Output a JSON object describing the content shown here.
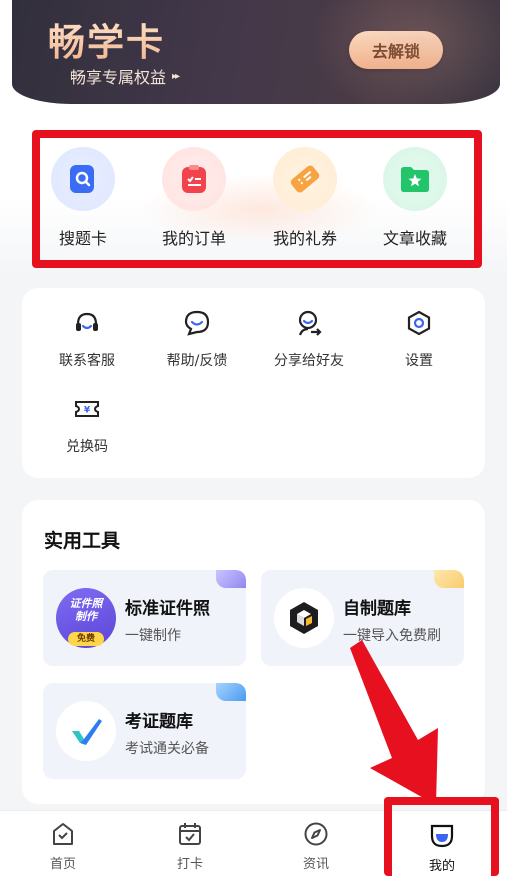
{
  "banner": {
    "title": "畅学卡",
    "subtitle": "畅享专属权益",
    "arrows": "▸▸",
    "unlock_label": "去解锁"
  },
  "quick_entries": [
    {
      "label": "搜题卡",
      "icon": "search-card-icon",
      "color": "#3b6cf6"
    },
    {
      "label": "我的订单",
      "icon": "order-clipboard-icon",
      "color": "#f2434d"
    },
    {
      "label": "我的礼券",
      "icon": "coupon-ticket-icon",
      "color": "#f7a341"
    },
    {
      "label": "文章收藏",
      "icon": "star-folder-icon",
      "color": "#22c56a"
    }
  ],
  "services": [
    {
      "label": "联系客服",
      "icon": "headset-icon"
    },
    {
      "label": "帮助/反馈",
      "icon": "chat-bubble-icon"
    },
    {
      "label": "分享给好友",
      "icon": "share-user-icon"
    },
    {
      "label": "设置",
      "icon": "settings-hexagon-icon"
    },
    {
      "label": "兑换码",
      "icon": "redeem-ticket-icon"
    }
  ],
  "tools": {
    "title": "实用工具",
    "items": [
      {
        "name": "标准证件照",
        "desc": "一键制作",
        "icon": "id-photo-badge-icon",
        "badge_lines": [
          "证件照",
          "制作"
        ],
        "badge_free": "免费"
      },
      {
        "name": "自制题库",
        "desc": "一键导入免费刷",
        "icon": "cube-box-icon"
      },
      {
        "name": "考证题库",
        "desc": "考试通关必备",
        "icon": "checkmark-logo-icon"
      }
    ]
  },
  "bottom_nav": [
    {
      "label": "首页",
      "icon": "home-icon",
      "active": false
    },
    {
      "label": "打卡",
      "icon": "calendar-check-icon",
      "active": false
    },
    {
      "label": "资讯",
      "icon": "compass-icon",
      "active": false
    },
    {
      "label": "我的",
      "icon": "profile-face-icon",
      "active": true
    }
  ],
  "colors": {
    "highlight_red": "#e6101e",
    "nav_active_blue": "#3d63f2"
  }
}
